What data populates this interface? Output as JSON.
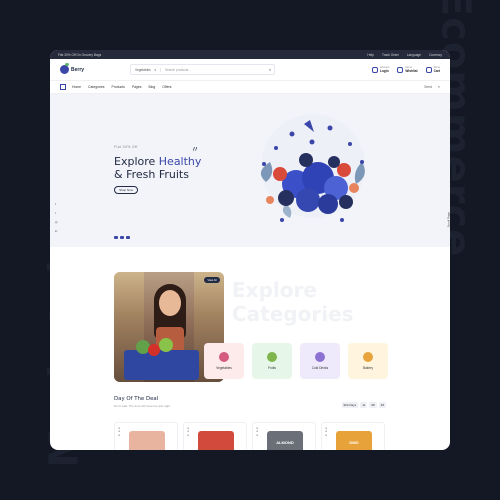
{
  "watermark": {
    "left": "Marketplace",
    "right": "Ecommerce"
  },
  "topbar": {
    "promo": "Flat 30% Off On Grocery Bags",
    "links": [
      "Help",
      "Track Order",
      "Language",
      "Currency"
    ]
  },
  "header": {
    "logo": "Berry",
    "search_category": "Vegetables",
    "search_placeholder": "Search products...",
    "actions": [
      {
        "small": "Account",
        "big": "Login",
        "icon": "user-icon"
      },
      {
        "small": "Items",
        "big": "Wishlist",
        "icon": "heart-icon"
      },
      {
        "small": "Items",
        "big": "Cart",
        "icon": "cart-icon"
      }
    ]
  },
  "nav": {
    "items": [
      "Home",
      "Categories",
      "Products",
      "Pages",
      "Blog",
      "Offers"
    ],
    "right_label": "Seed"
  },
  "hero": {
    "kicker": "Flat 30% Off",
    "title_line1_plain": "Explore ",
    "title_line1_highlight": "Healthy",
    "title_line2": "& Fresh Fruits",
    "button": "Shop Now",
    "side_right": "Scroll Page"
  },
  "explore": {
    "title_line1": "Explore",
    "title_line2": "Categories",
    "photo_badge": "View All",
    "categories": [
      {
        "label": "Vegetables",
        "bg": "#fdeaea",
        "icon_color": "#d45b7c"
      },
      {
        "label": "Fruits",
        "bg": "#e6f6e9",
        "icon_color": "#7fb54c"
      },
      {
        "label": "Cold Drinks",
        "bg": "#efeafb",
        "icon_color": "#8c73d1"
      },
      {
        "label": "Bakery",
        "bg": "#fff4de",
        "icon_color": "#e8a33c"
      }
    ]
  },
  "deals": {
    "title": "Day Of The Deal",
    "subtitle": "Don't wait. The time will never be just right.",
    "countdown": [
      "992 Days",
      "11",
      "08",
      "48"
    ]
  },
  "products": [
    {
      "label": "",
      "color": "#e8b4a0"
    },
    {
      "label": "",
      "color": "#d24a3c"
    },
    {
      "label": "ALMOND",
      "color": "#6b6f78"
    },
    {
      "label": "DMO",
      "color": "#e7a23a"
    }
  ],
  "colors": {
    "brand": "#3b47a8",
    "dark": "#222b45"
  }
}
